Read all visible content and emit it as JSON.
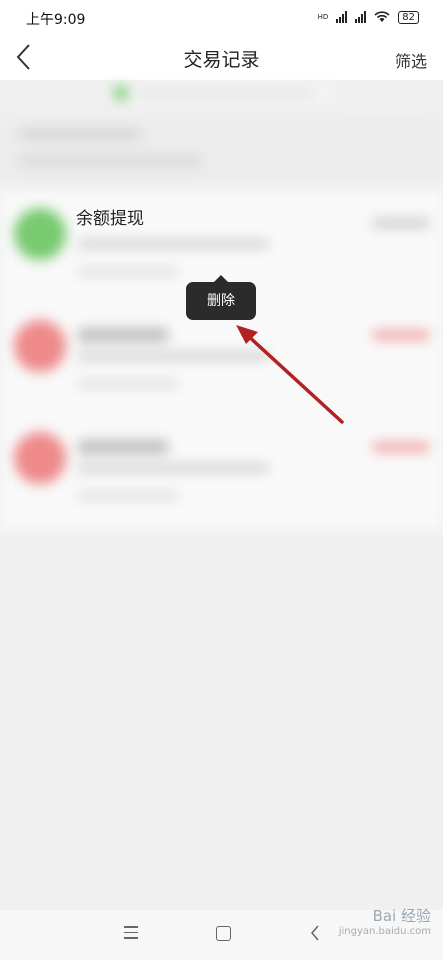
{
  "status": {
    "time": "上午9:09",
    "battery": "82",
    "network_label": "HD"
  },
  "header": {
    "title": "交易记录",
    "filter_label": "筛选"
  },
  "transactions": [
    {
      "title": "余额提现",
      "avatar_color": "#6cc763",
      "amount_color": "#cccccc"
    },
    {
      "title": "",
      "avatar_color": "#ee8080",
      "amount_color": "#f3a2a2"
    },
    {
      "title": "",
      "avatar_color": "#ee8080",
      "amount_color": "#f3a2a2"
    }
  ],
  "context_menu": {
    "delete_label": "删除"
  },
  "annotation": {
    "arrow_color": "#b22222"
  },
  "watermark": {
    "title": "Bai 经验",
    "url": "jingyan.baidu.com"
  },
  "icons": {
    "back": "chevron-left-icon",
    "nav_menu": "menu-icon",
    "nav_home": "home-icon",
    "nav_back": "back-icon"
  }
}
